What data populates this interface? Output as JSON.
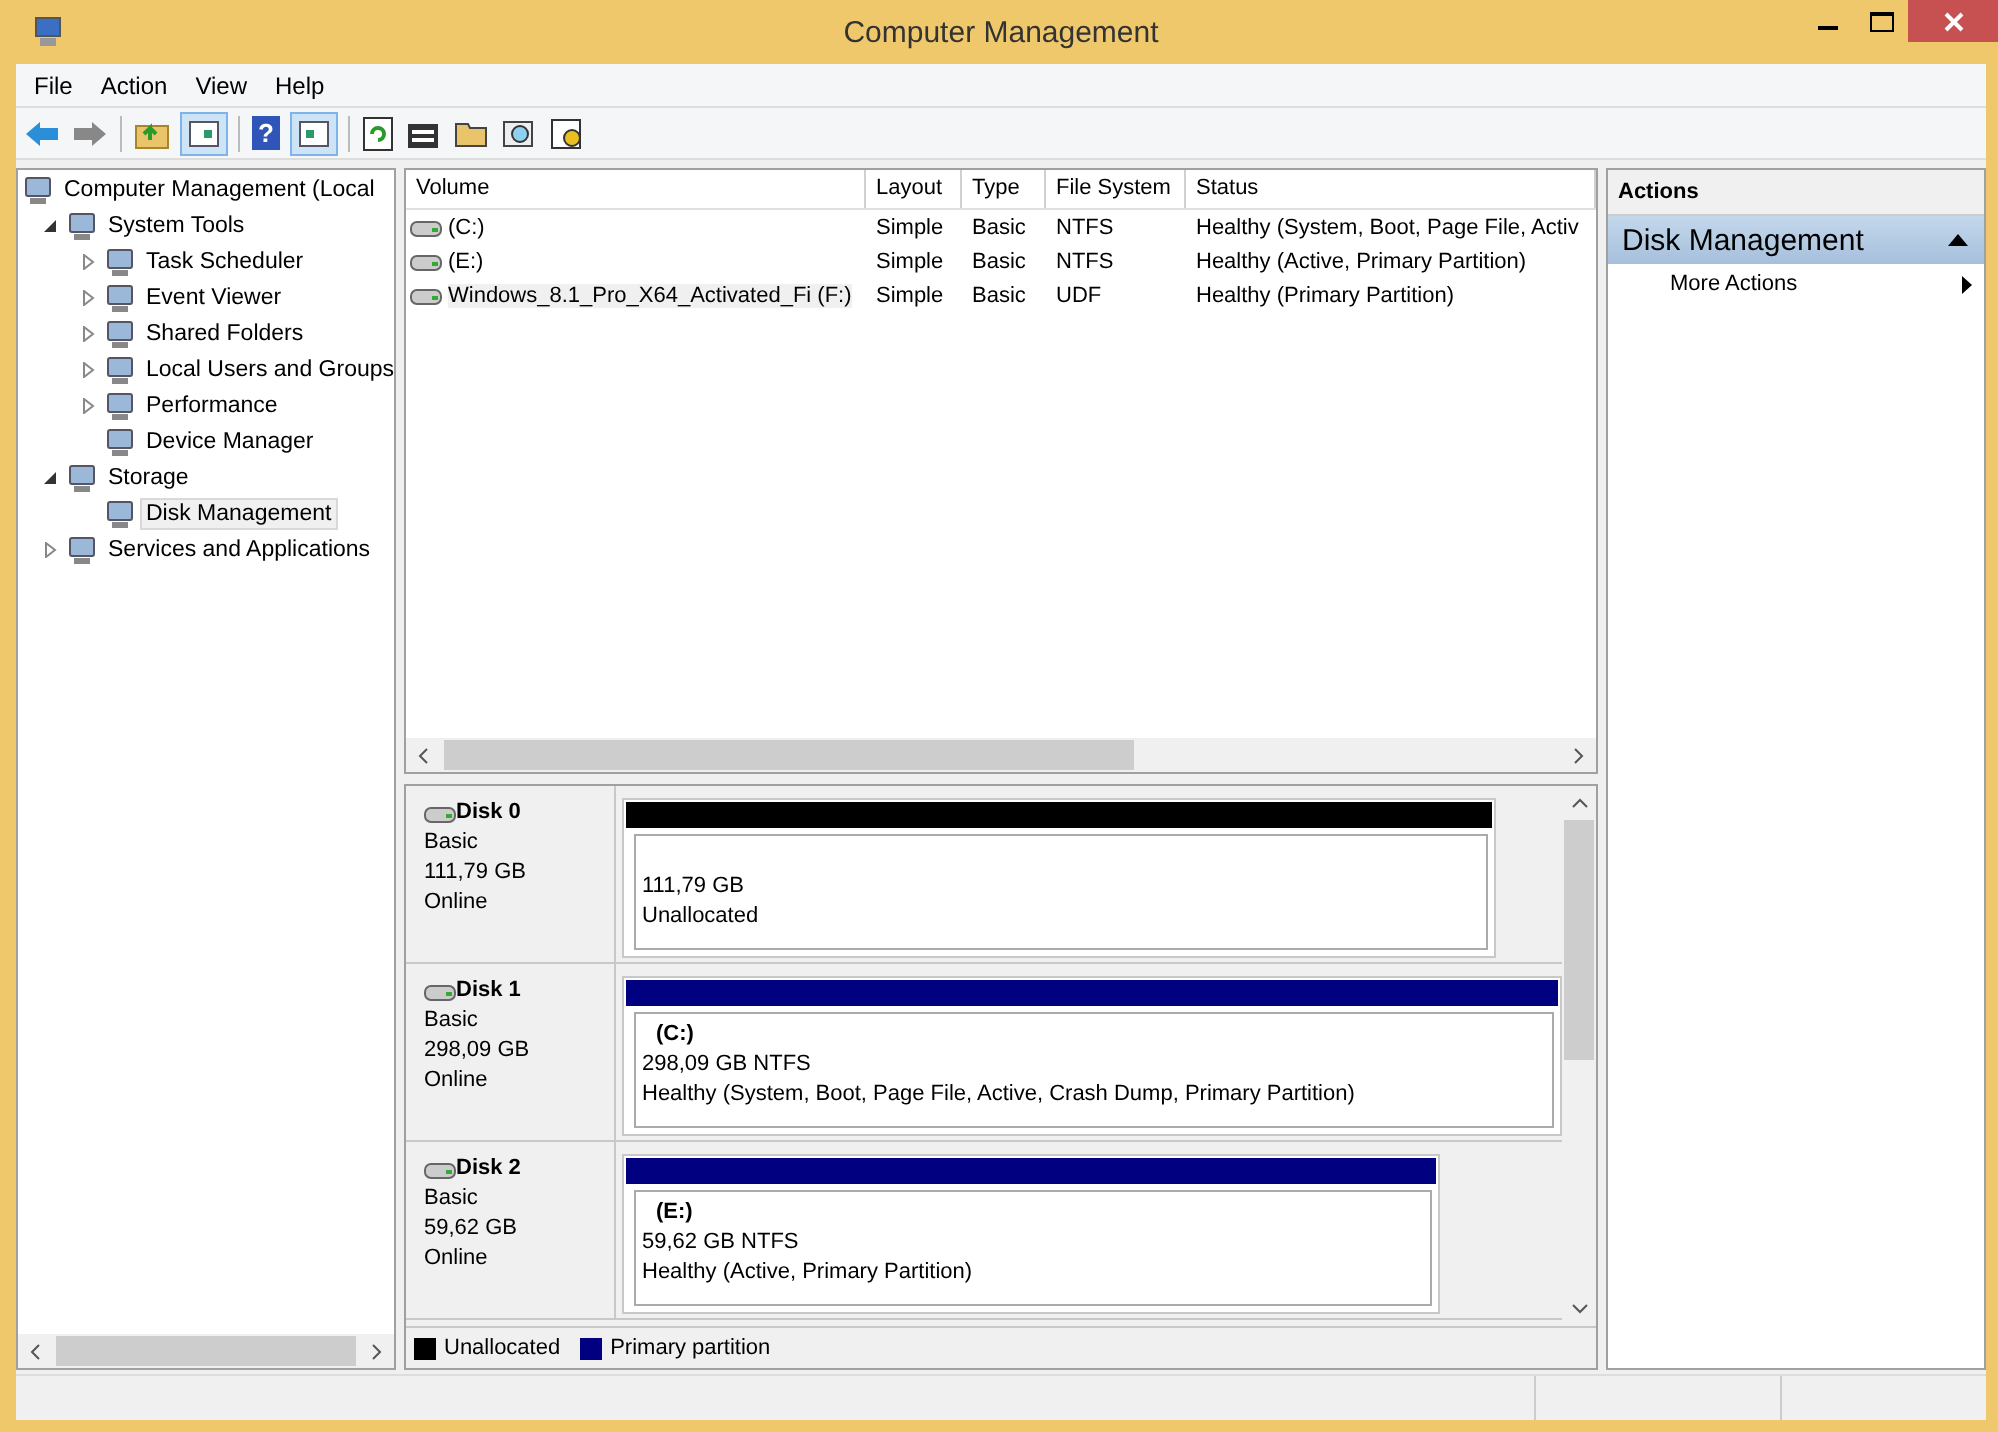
{
  "window": {
    "title": "Computer Management"
  },
  "menu": [
    "File",
    "Action",
    "View",
    "Help"
  ],
  "toolbar": {
    "help_glyph": "?"
  },
  "tree": [
    {
      "label": "Computer Management (Local",
      "selected": false,
      "children": [
        {
          "label": "System Tools",
          "expanded": true,
          "selected": false,
          "children": [
            {
              "label": "Task Scheduler",
              "expanded": false,
              "selected": false
            },
            {
              "label": "Event Viewer",
              "expanded": false,
              "selected": false
            },
            {
              "label": "Shared Folders",
              "expanded": false,
              "selected": false
            },
            {
              "label": "Local Users and Groups",
              "expanded": false,
              "selected": false
            },
            {
              "label": "Performance",
              "expanded": false,
              "selected": false
            },
            {
              "label": "Device Manager",
              "selected": false
            }
          ]
        },
        {
          "label": "Storage",
          "expanded": true,
          "selected": false,
          "children": [
            {
              "label": "Disk Management",
              "selected": true
            }
          ]
        },
        {
          "label": "Services and Applications",
          "expanded": false,
          "selected": false
        }
      ]
    }
  ],
  "volumes": {
    "columns": [
      "Volume",
      "Layout",
      "Type",
      "File System",
      "Status"
    ],
    "rows": [
      {
        "selected": false,
        "cells": [
          "(C:)",
          "Simple",
          "Basic",
          "NTFS",
          "Healthy (System, Boot, Page File, Activ"
        ]
      },
      {
        "selected": false,
        "cells": [
          "(E:)",
          "Simple",
          "Basic",
          "NTFS",
          "Healthy (Active, Primary Partition)"
        ]
      },
      {
        "selected": true,
        "cells": [
          "Windows_8.1_Pro_X64_Activated_Fi (F:)",
          "Simple",
          "Basic",
          "UDF",
          "Healthy (Primary Partition)"
        ]
      }
    ]
  },
  "disks": [
    {
      "name": "Disk 0",
      "type": "Basic",
      "size": "111,79 GB",
      "status": "Online",
      "partitions": [
        {
          "kind": "unallocated",
          "size": "111,79 GB",
          "status": "Unallocated"
        }
      ]
    },
    {
      "name": "Disk 1",
      "type": "Basic",
      "size": "298,09 GB",
      "status": "Online",
      "partitions": [
        {
          "kind": "primary",
          "label": "(C:)",
          "size": "298,09 GB NTFS",
          "status": "Healthy (System, Boot, Page File, Active, Crash Dump, Primary Partition)"
        }
      ]
    },
    {
      "name": "Disk 2",
      "type": "Basic",
      "size": "59,62 GB",
      "status": "Online",
      "partitions": [
        {
          "kind": "primary",
          "label": "(E:)",
          "size": "59,62 GB NTFS",
          "status": "Healthy (Active, Primary Partition)"
        }
      ]
    }
  ],
  "legend": [
    {
      "label": "Unallocated",
      "color": "#000000"
    },
    {
      "label": "Primary partition",
      "color": "#000080"
    }
  ],
  "actions": {
    "header": "Actions",
    "section": {
      "label": "Disk Management",
      "expanded": true,
      "items": [
        "More Actions"
      ]
    }
  }
}
